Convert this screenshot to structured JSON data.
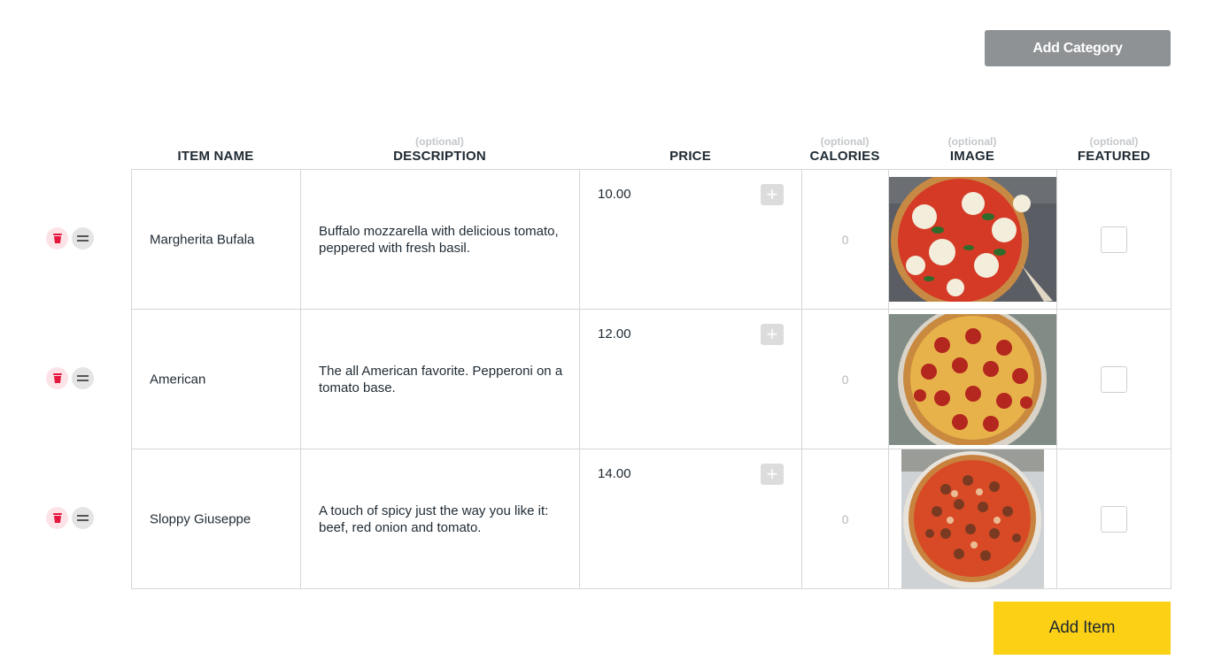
{
  "toolbar": {
    "add_category_label": "Add Category"
  },
  "columns": [
    {
      "title": "ITEM NAME",
      "optional": ""
    },
    {
      "title": "DESCRIPTION",
      "optional": "(optional)"
    },
    {
      "title": "PRICE",
      "optional": ""
    },
    {
      "title": "CALORIES",
      "optional": "(optional)"
    },
    {
      "title": "IMAGE",
      "optional": "(optional)"
    },
    {
      "title": "FEATURED",
      "optional": "(optional)"
    }
  ],
  "items": [
    {
      "name": "Margherita Bufala",
      "description": "Buffalo mozzarella with delicious tomato, peppered with fresh basil.",
      "price": "10.00",
      "calories": "0",
      "image": "pizza-margherita",
      "featured": false
    },
    {
      "name": "American",
      "description": "The all American favorite. Pepperoni on a tomato base.",
      "price": "12.00",
      "calories": "0",
      "image": "pizza-pepperoni",
      "featured": false
    },
    {
      "name": "Sloppy Giuseppe",
      "description": "A touch of spicy just the way you like it: beef, red onion and tomato.",
      "price": "14.00",
      "calories": "0",
      "image": "pizza-beef",
      "featured": false
    }
  ],
  "icons": {
    "plus": "+",
    "delete": "trash-icon",
    "drag": "drag-handle-icon"
  },
  "footer": {
    "add_item_label": "Add Item"
  },
  "colors": {
    "accent_yellow": "#fcd015",
    "delete_red": "#e5173f",
    "secondary_gray": "#8e9295"
  }
}
